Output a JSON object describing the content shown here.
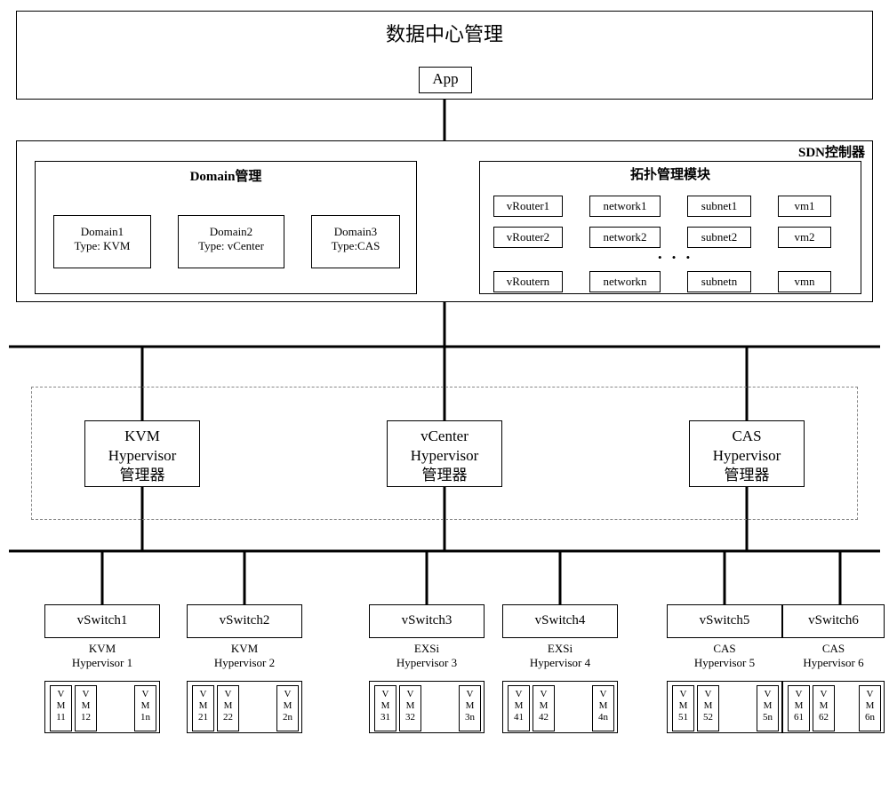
{
  "header": {
    "title": "数据中心管理",
    "app": "App"
  },
  "sdn": {
    "title": "SDN控制器",
    "domain": {
      "title": "Domain管理",
      "items": [
        {
          "name": "Domain1",
          "type": "Type: KVM"
        },
        {
          "name": "Domain2",
          "type": "Type: vCenter"
        },
        {
          "name": "Domain3",
          "type": "Type:CAS"
        }
      ]
    },
    "topology": {
      "title": "拓扑管理模块",
      "rows": [
        [
          "vRouter1",
          "network1",
          "subnet1",
          "vm1"
        ],
        [
          "vRouter2",
          "network2",
          "subnet2",
          "vm2"
        ],
        [
          "vRoutern",
          "networkn",
          "subnetn",
          "vmn"
        ]
      ],
      "ellipsis": "• • •"
    }
  },
  "hypervisors": [
    {
      "name": "KVM",
      "sub": "Hypervisor",
      "mgr": "管理器"
    },
    {
      "name": "vCenter",
      "sub": "Hypervisor",
      "mgr": "管理器"
    },
    {
      "name": "CAS",
      "sub": "Hypervisor",
      "mgr": "管理器"
    }
  ],
  "switches": [
    {
      "vs": "vSwitch1",
      "hv1": "KVM",
      "hv2": "Hypervisor 1",
      "vms": [
        "V M 11",
        "V M 12",
        "V M 1n"
      ]
    },
    {
      "vs": "vSwitch2",
      "hv1": "KVM",
      "hv2": "Hypervisor 2",
      "vms": [
        "V M 21",
        "V M 22",
        "V M 2n"
      ]
    },
    {
      "vs": "vSwitch3",
      "hv1": "EXSi",
      "hv2": "Hypervisor 3",
      "vms": [
        "V M 31",
        "V M 32",
        "V M 3n"
      ]
    },
    {
      "vs": "vSwitch4",
      "hv1": "EXSi",
      "hv2": "Hypervisor 4",
      "vms": [
        "V M 41",
        "V M 42",
        "V M 4n"
      ]
    },
    {
      "vs": "vSwitch5",
      "hv1": "CAS",
      "hv2": "Hypervisor 5",
      "vms": [
        "V M 51",
        "V M 52",
        "V M 5n"
      ]
    },
    {
      "vs": "vSwitch6",
      "hv1": "CAS",
      "hv2": "Hypervisor 6",
      "vms": [
        "V M 61",
        "V M 62",
        "V M 6n"
      ]
    }
  ]
}
